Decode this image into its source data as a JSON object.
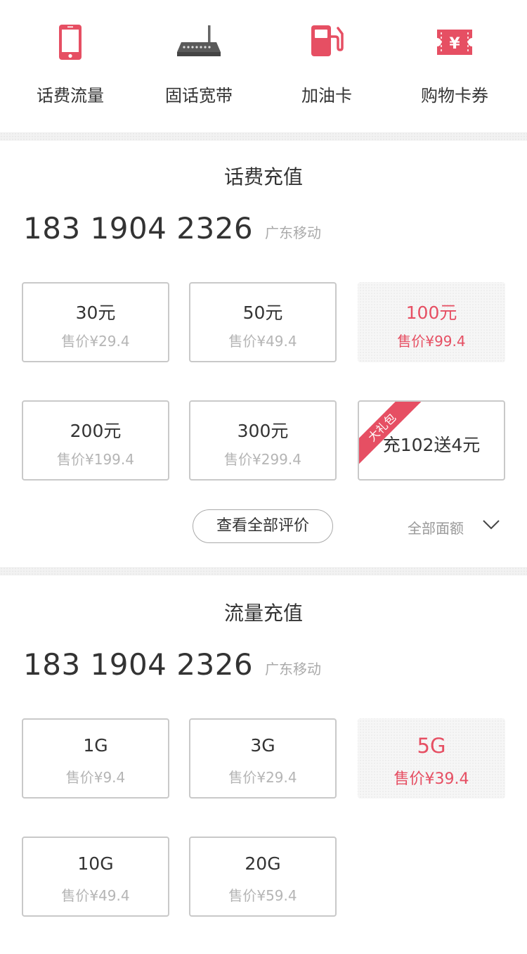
{
  "nav": [
    {
      "label": "话费流量",
      "icon": "phone-icon"
    },
    {
      "label": "固话宽带",
      "icon": "router-icon"
    },
    {
      "label": "加油卡",
      "icon": "fuel-pump-icon"
    },
    {
      "label": "购物卡券",
      "icon": "coupon-icon"
    }
  ],
  "recharge": {
    "title": "话费充值",
    "phone": "183 1904 2326",
    "carrier": "广东移动",
    "options": [
      {
        "amount": "30元",
        "price": "售价¥29.4"
      },
      {
        "amount": "50元",
        "price": "售价¥49.4"
      },
      {
        "amount": "100元",
        "price": "售价¥99.4",
        "selected": true
      },
      {
        "amount": "200元",
        "price": "售价¥199.4"
      },
      {
        "amount": "300元",
        "price": "售价¥299.4"
      },
      {
        "amount": "充102送4元",
        "badge": "大礼包"
      }
    ],
    "reviews_button": "查看全部评价",
    "all_denoms": "全部面额"
  },
  "data_recharge": {
    "title": "流量充值",
    "phone": "183 1904 2326",
    "carrier": "广东移动",
    "options": [
      {
        "amount": "1G",
        "price": "售价¥9.4"
      },
      {
        "amount": "3G",
        "price": "售价¥29.4"
      },
      {
        "amount": "5G",
        "price": "售价¥39.4",
        "selected": true
      },
      {
        "amount": "10G",
        "price": "售价¥49.4"
      },
      {
        "amount": "20G",
        "price": "售价¥59.4"
      }
    ]
  },
  "colors": {
    "accent": "#e64f63",
    "text": "#333333",
    "muted": "#b5b5b5"
  }
}
